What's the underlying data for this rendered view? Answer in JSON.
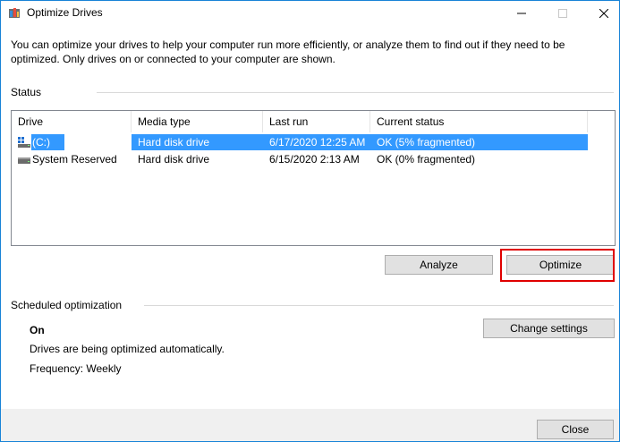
{
  "window": {
    "title": "Optimize Drives",
    "title_bar_buttons": [
      "minimize",
      "maximize",
      "close"
    ]
  },
  "intro_text": "You can optimize your drives to help your computer run more efficiently, or analyze them to find out if they need to be optimized. Only drives on or connected to your computer are shown.",
  "status": {
    "label": "Status",
    "columns": [
      "Drive",
      "Media type",
      "Last run",
      "Current status"
    ],
    "rows": [
      {
        "drive": "(C:)",
        "media_type": "Hard disk drive",
        "last_run": "6/17/2020 12:25 AM",
        "current_status": "OK (5% fragmented)",
        "selected": true,
        "icon": "windows-drive-icon"
      },
      {
        "drive": "System Reserved",
        "media_type": "Hard disk drive",
        "last_run": "6/15/2020 2:13 AM",
        "current_status": "OK (0% fragmented)",
        "selected": false,
        "icon": "drive-icon"
      }
    ]
  },
  "buttons": {
    "analyze": "Analyze",
    "optimize": "Optimize",
    "change_settings": "Change settings",
    "close": "Close"
  },
  "scheduled": {
    "label": "Scheduled optimization",
    "state": "On",
    "description": "Drives are being optimized automatically.",
    "frequency": "Frequency: Weekly"
  },
  "colors": {
    "selection": "#3399ff",
    "highlight_box": "#e00000",
    "window_border": "#1883d7"
  }
}
